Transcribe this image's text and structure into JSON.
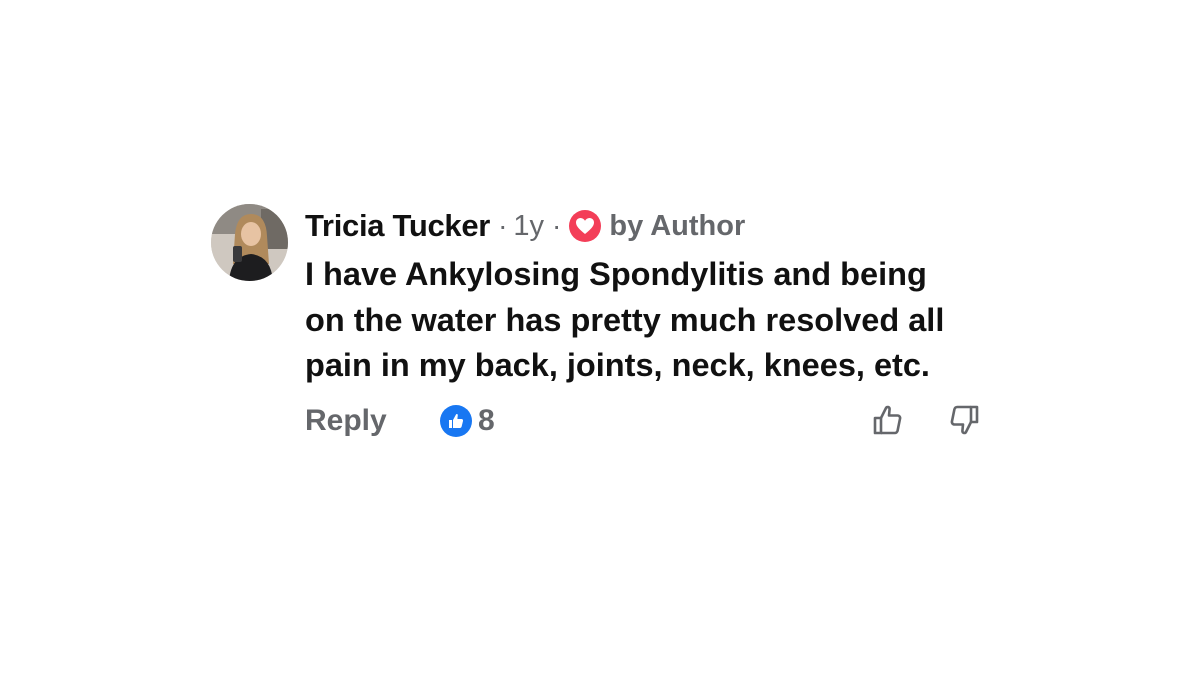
{
  "comment": {
    "author": "Tricia Tucker",
    "separator_1": "·",
    "time": "1y",
    "separator_2": "·",
    "loved_by": "by Author",
    "text": "I have Ankylosing Spondylitis and being on the water has pretty much resolved all pain in my back, joints, neck, knees, etc.",
    "actions": {
      "reply_label": "Reply",
      "like_count": "8"
    }
  },
  "icons": {
    "avatar": "user-photo",
    "loved": "heart-icon",
    "like_badge": "thumbs-up-icon",
    "upvote": "thumbs-up-outline-icon",
    "downvote": "thumbs-down-outline-icon"
  },
  "colors": {
    "author_text": "#111111",
    "secondary_text": "#65676b",
    "heart_red": "#f33e58",
    "like_blue": "#1877f2"
  }
}
